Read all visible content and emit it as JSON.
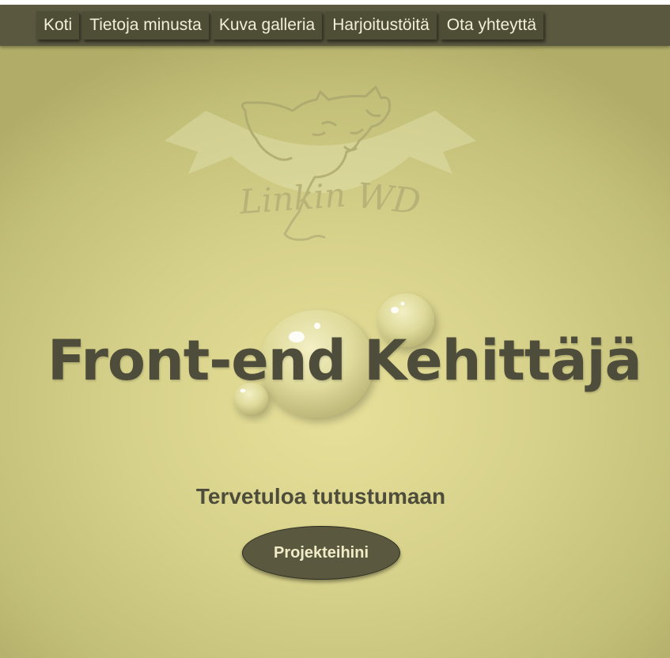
{
  "nav": {
    "items": [
      {
        "label": "Koti"
      },
      {
        "label": "Tietoja minusta"
      },
      {
        "label": "Kuva galleria"
      },
      {
        "label": "Harjoitustöitä"
      },
      {
        "label": "Ota yhteyttä"
      }
    ]
  },
  "logo": {
    "text_main": "Linkin",
    "text_accent": "WD",
    "icon": "wolf-head-icon"
  },
  "hero": {
    "title": "Front-end Kehittäjä",
    "subtitle": "Tervetuloa tutustumaan",
    "cta_label": "Projekteihini"
  },
  "colors": {
    "nav_bg": "#5a583f",
    "text_dark": "#4e4c3a",
    "bg_light": "#e7e09a",
    "button_text": "#f0ecc8"
  }
}
